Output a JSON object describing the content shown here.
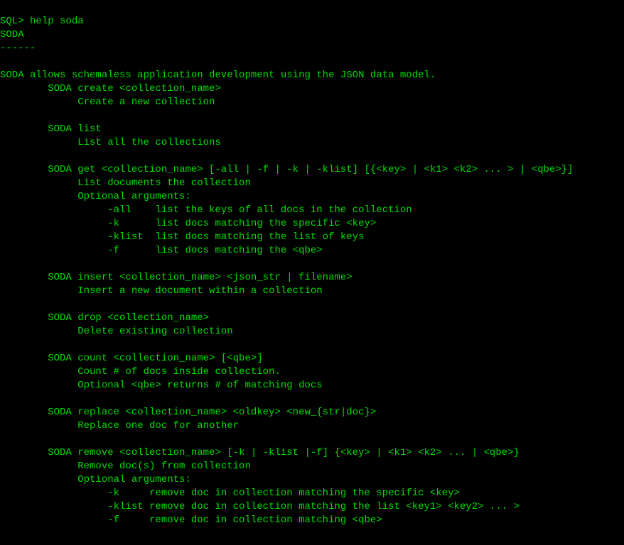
{
  "prompt": "SQL> ",
  "command": "help soda",
  "header_title": "SODA",
  "header_underline": "------",
  "blank": "",
  "intro": "SODA allows schemaless application development using the JSON data model.",
  "sections": {
    "create": {
      "usage": "        SODA create <collection_name>",
      "desc": "             Create a new collection"
    },
    "list": {
      "usage": "        SODA list",
      "desc": "             List all the collections"
    },
    "get": {
      "usage": "        SODA get <collection_name> [-all | -f | -k | -klist] [{<key> | <k1> <k2> ... > | <qbe>}]",
      "desc": "             List documents the collection",
      "optlbl": "             Optional arguments:",
      "opt_all": "                  -all    list the keys of all docs in the collection",
      "opt_k": "                  -k      list docs matching the specific <key>",
      "opt_klist": "                  -klist  list docs matching the list of keys",
      "opt_f": "                  -f      list docs matching the <qbe>"
    },
    "insert": {
      "usage": "        SODA insert <collection_name> <json_str | filename>",
      "desc": "             Insert a new document within a collection"
    },
    "drop": {
      "usage": "        SODA drop <collection_name>",
      "desc": "             Delete existing collection"
    },
    "count": {
      "usage": "        SODA count <collection_name> [<qbe>]",
      "desc": "             Count # of docs inside collection.",
      "desc2": "             Optional <qbe> returns # of matching docs"
    },
    "replace": {
      "usage": "        SODA replace <collection_name> <oldkey> <new_{str|doc}>",
      "desc": "             Replace one doc for another"
    },
    "remove": {
      "usage": "        SODA remove <collection_name> [-k | -klist |-f] {<key> | <k1> <k2> ... | <qbe>}",
      "desc": "             Remove doc(s) from collection",
      "optlbl": "             Optional arguments:",
      "opt_k": "                  -k     remove doc in collection matching the specific <key>",
      "opt_klist": "                  -klist remove doc in collection matching the list <key1> <key2> ... >",
      "opt_f": "                  -f     remove doc in collection matching <qbe>"
    }
  }
}
